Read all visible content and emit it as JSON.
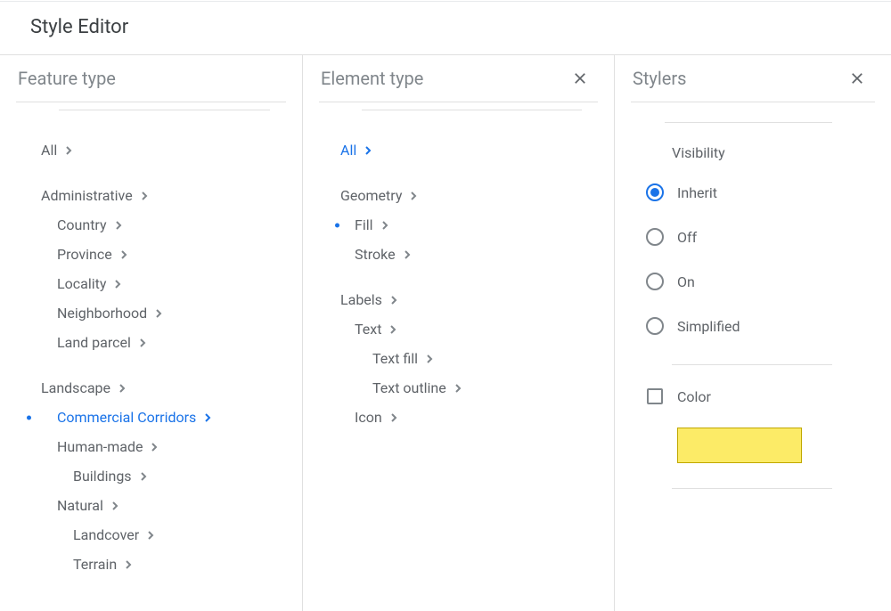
{
  "title": "Style Editor",
  "columns": {
    "feature": {
      "title": "Feature type"
    },
    "element": {
      "title": "Element type"
    },
    "stylers": {
      "title": "Stylers"
    }
  },
  "featureTree": {
    "all": "All",
    "administrative": "Administrative",
    "country": "Country",
    "province": "Province",
    "locality": "Locality",
    "neighborhood": "Neighborhood",
    "landParcel": "Land parcel",
    "landscape": "Landscape",
    "commercialCorridors": "Commercial Corridors",
    "humanMade": "Human-made",
    "buildings": "Buildings",
    "natural": "Natural",
    "landcover": "Landcover",
    "terrain": "Terrain"
  },
  "elementTree": {
    "all": "All",
    "geometry": "Geometry",
    "fill": "Fill",
    "stroke": "Stroke",
    "labels": "Labels",
    "text": "Text",
    "textFill": "Text fill",
    "textOutline": "Text outline",
    "icon": "Icon"
  },
  "stylers": {
    "visibility": {
      "label": "Visibility",
      "options": {
        "inherit": "Inherit",
        "off": "Off",
        "on": "On",
        "simplified": "Simplified"
      },
      "selected": "inherit"
    },
    "color": {
      "label": "Color",
      "value": "#fceb67"
    }
  }
}
